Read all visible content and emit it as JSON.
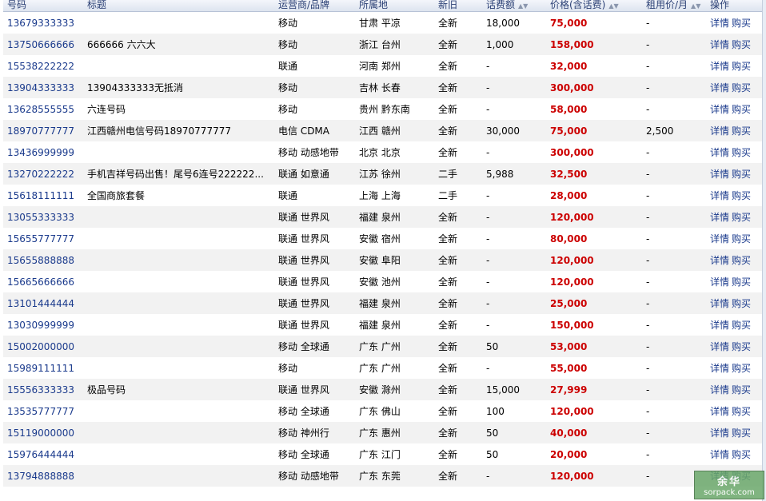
{
  "columns": [
    {
      "label": "号码",
      "sortable": false
    },
    {
      "label": "标题",
      "sortable": false
    },
    {
      "label": "运营商/品牌",
      "sortable": false
    },
    {
      "label": "所属地",
      "sortable": false
    },
    {
      "label": "新旧",
      "sortable": false
    },
    {
      "label": "话费额",
      "sortable": true
    },
    {
      "label": "价格(含话费)",
      "sortable": true
    },
    {
      "label": "租用价/月",
      "sortable": true
    },
    {
      "label": "操作",
      "sortable": false
    }
  ],
  "row_actions": {
    "detail": "详情",
    "buy": "购买"
  },
  "rows": [
    {
      "number": "13679333333",
      "title": "",
      "carrier": "移动",
      "location": "甘肃 平凉",
      "condition": "全新",
      "credit": "18,000",
      "price": "75,000",
      "rent": "-"
    },
    {
      "number": "13750666666",
      "title": "666666 六六大",
      "carrier": "移动",
      "location": "浙江 台州",
      "condition": "全新",
      "credit": "1,000",
      "price": "158,000",
      "rent": "-"
    },
    {
      "number": "15538222222",
      "title": "",
      "carrier": "联通",
      "location": "河南 郑州",
      "condition": "全新",
      "credit": "-",
      "price": "32,000",
      "rent": "-"
    },
    {
      "number": "13904333333",
      "title": "13904333333无抵消",
      "carrier": "移动",
      "location": "吉林 长春",
      "condition": "全新",
      "credit": "-",
      "price": "300,000",
      "rent": "-"
    },
    {
      "number": "13628555555",
      "title": "六连号码",
      "carrier": "移动",
      "location": "贵州 黔东南",
      "condition": "全新",
      "credit": "-",
      "price": "58,000",
      "rent": "-"
    },
    {
      "number": "18970777777",
      "title": "江西赣州电信号码18970777777",
      "carrier": "电信 CDMA",
      "location": "江西 赣州",
      "condition": "全新",
      "credit": "30,000",
      "price": "75,000",
      "rent": "2,500"
    },
    {
      "number": "13436999999",
      "title": "",
      "carrier": "移动 动感地带",
      "location": "北京 北京",
      "condition": "全新",
      "credit": "-",
      "price": "300,000",
      "rent": "-"
    },
    {
      "number": "13270222222",
      "title": "手机吉祥号码出售！尾号6连号222222...",
      "carrier": "联通 如意通",
      "location": "江苏 徐州",
      "condition": "二手",
      "credit": "5,988",
      "price": "32,500",
      "rent": "-"
    },
    {
      "number": "15618111111",
      "title": "全国商旅套餐",
      "carrier": "联通",
      "location": "上海 上海",
      "condition": "二手",
      "credit": "-",
      "price": "28,000",
      "rent": "-"
    },
    {
      "number": "13055333333",
      "title": "",
      "carrier": "联通 世界风",
      "location": "福建 泉州",
      "condition": "全新",
      "credit": "-",
      "price": "120,000",
      "rent": "-"
    },
    {
      "number": "15655777777",
      "title": "",
      "carrier": "联通 世界风",
      "location": "安徽 宿州",
      "condition": "全新",
      "credit": "-",
      "price": "80,000",
      "rent": "-"
    },
    {
      "number": "15655888888",
      "title": "",
      "carrier": "联通 世界风",
      "location": "安徽 阜阳",
      "condition": "全新",
      "credit": "-",
      "price": "120,000",
      "rent": "-"
    },
    {
      "number": "15665666666",
      "title": "",
      "carrier": "联通 世界风",
      "location": "安徽 池州",
      "condition": "全新",
      "credit": "-",
      "price": "120,000",
      "rent": "-"
    },
    {
      "number": "13101444444",
      "title": "",
      "carrier": "联通 世界风",
      "location": "福建 泉州",
      "condition": "全新",
      "credit": "-",
      "price": "25,000",
      "rent": "-"
    },
    {
      "number": "13030999999",
      "title": "",
      "carrier": "联通 世界风",
      "location": "福建 泉州",
      "condition": "全新",
      "credit": "-",
      "price": "150,000",
      "rent": "-"
    },
    {
      "number": "15002000000",
      "title": "",
      "carrier": "移动 全球通",
      "location": "广东 广州",
      "condition": "全新",
      "credit": "50",
      "price": "53,000",
      "rent": "-"
    },
    {
      "number": "15989111111",
      "title": "",
      "carrier": "移动",
      "location": "广东 广州",
      "condition": "全新",
      "credit": "-",
      "price": "55,000",
      "rent": "-"
    },
    {
      "number": "15556333333",
      "title": "极品号码",
      "carrier": "联通 世界风",
      "location": "安徽 滁州",
      "condition": "全新",
      "credit": "15,000",
      "price": "27,999",
      "rent": "-"
    },
    {
      "number": "13535777777",
      "title": "",
      "carrier": "移动 全球通",
      "location": "广东 佛山",
      "condition": "全新",
      "credit": "100",
      "price": "120,000",
      "rent": "-"
    },
    {
      "number": "15119000000",
      "title": "",
      "carrier": "移动 神州行",
      "location": "广东 惠州",
      "condition": "全新",
      "credit": "50",
      "price": "40,000",
      "rent": "-"
    },
    {
      "number": "15976444444",
      "title": "",
      "carrier": "移动 全球通",
      "location": "广东 江门",
      "condition": "全新",
      "credit": "50",
      "price": "20,000",
      "rent": "-"
    },
    {
      "number": "13794888888",
      "title": "",
      "carrier": "移动 动感地带",
      "location": "广东 东莞",
      "condition": "全新",
      "credit": "-",
      "price": "120,000",
      "rent": "-"
    }
  ],
  "watermark": {
    "logo": "余华",
    "text": "sorpack.com"
  },
  "colors": {
    "header_text": "#2a3f74",
    "link": "#1a3a8c",
    "price": "#cc0000",
    "row_alt": "#f2f2f2"
  }
}
